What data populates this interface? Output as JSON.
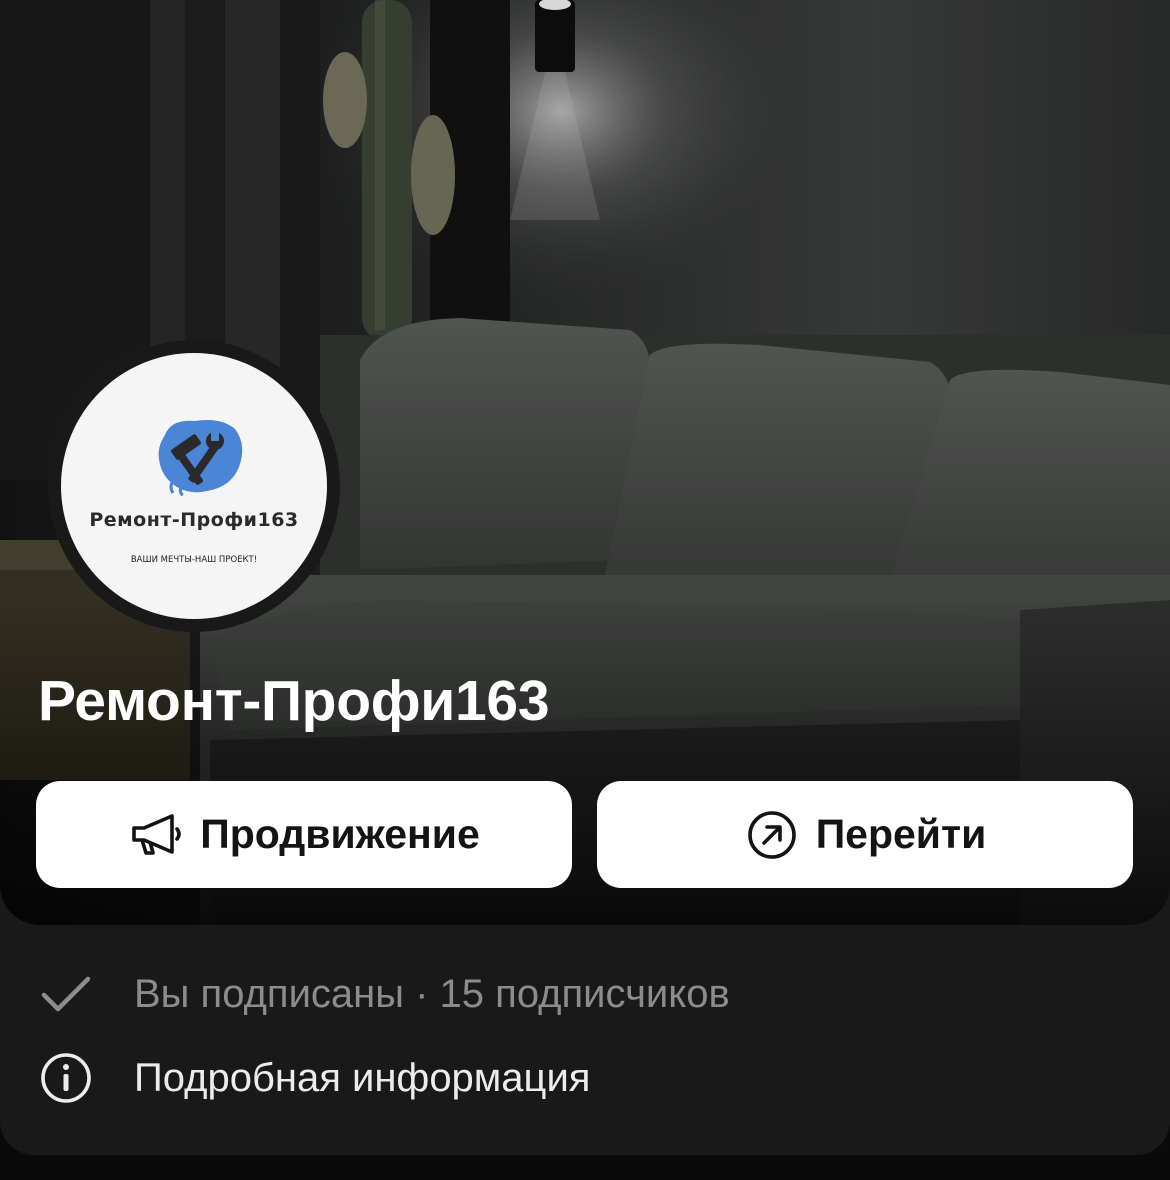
{
  "group": {
    "name": "Ремонт-Профи163"
  },
  "avatar": {
    "logo_title": "Ремонт-Профи163",
    "logo_slogan": "ВАШИ МЕЧТЫ-НАШ ПРОЕКТ!",
    "logo_icon": "hammer-wrench-icon",
    "logo_color": "#4a85d6"
  },
  "actions": {
    "promote": {
      "label": "Продвижение",
      "icon": "megaphone-icon"
    },
    "open": {
      "label": "Перейти",
      "icon": "arrow-up-right-circle-icon"
    }
  },
  "info": {
    "subscription": {
      "text": "Вы подписаны · 15 подписчиков",
      "icon": "checkmark-icon"
    },
    "details": {
      "text": "Подробная информация",
      "icon": "info-circle-icon"
    }
  },
  "colors": {
    "background": "#191919",
    "button_bg": "#ffffff",
    "button_text": "#141414",
    "muted_text": "#8c8c8c"
  }
}
